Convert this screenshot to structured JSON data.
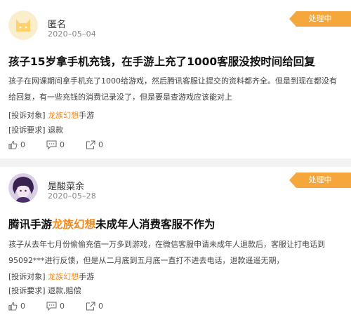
{
  "complaints": [
    {
      "user": "匿名",
      "date": "2020–05–04",
      "status": "处理中",
      "title": "孩子15岁拿手机充钱，在手游上充了1000客服没按时间给回复",
      "body": "孩子在网课期间拿手机充了1000给游戏，然后腾讯客服让提交的资料都齐全。但是到现在都没有给回复，有一些充钱的消费记录没了，但是要是查游戏应该能对上",
      "target_label": "[投诉对象]",
      "target_name": "龙族幻想",
      "target_suffix": "手游",
      "demand_label": "[投诉要求]",
      "demand": "退款",
      "likes": "0",
      "comments": "0",
      "shares": "0"
    },
    {
      "user": "是酸菜余",
      "date": "2020–05–28",
      "status": "处理中",
      "title_prefix": "腾讯手游",
      "title_highlight": "龙族幻想",
      "title_suffix": "未成年人消费客服不作为",
      "body": "孩子从去年七月份偷偷充值一万多到游戏，在微信客服申请未成年人退款后，客服让打电话到95092***进行反馈，但是从二月底到五月底一直打不进去电话，退款遥遥无期，",
      "target_label": "[投诉对象]",
      "target_name": "龙族幻想",
      "target_suffix": "手游",
      "demand_label": "[投诉要求]",
      "demand": "退款,赔偿",
      "likes": "0",
      "comments": "0",
      "shares": "0"
    }
  ],
  "colors": {
    "badge": "#f6a73b",
    "highlight": "#f08a1c",
    "separator": "#f3f3f3"
  },
  "icons": {
    "avatar1": "cat-avatar-icon",
    "avatar2": "anime-avatar-icon",
    "like": "thumbs-up-icon",
    "comment": "comment-icon",
    "share": "share-icon"
  }
}
